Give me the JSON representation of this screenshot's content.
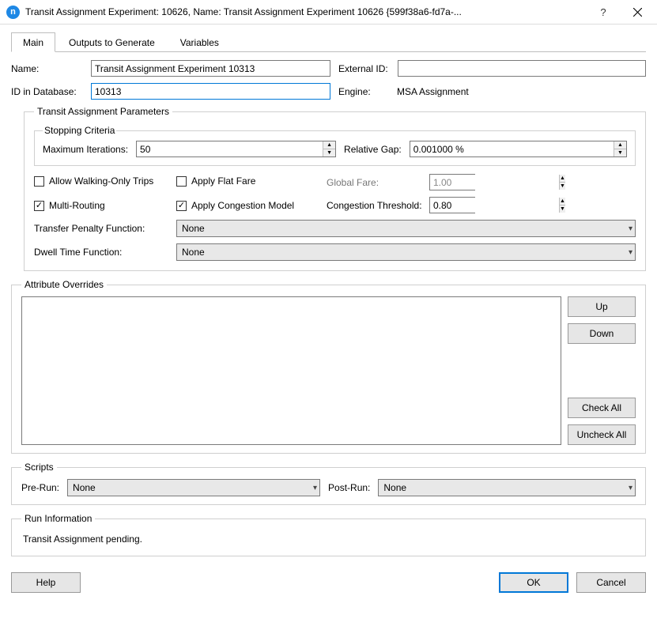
{
  "title": "Transit Assignment Experiment: 10626, Name: Transit Assignment Experiment 10626  {599f38a6-fd7a-...",
  "tabs": {
    "main": "Main",
    "outputs": "Outputs to Generate",
    "variables": "Variables"
  },
  "labels": {
    "name": "Name:",
    "external_id": "External ID:",
    "id_db": "ID in Database:",
    "engine": "Engine:"
  },
  "values": {
    "name": "Transit Assignment Experiment 10313",
    "external_id": "",
    "id_db": "10313",
    "engine": "MSA Assignment"
  },
  "params": {
    "legend": "Transit Assignment Parameters",
    "stopping_legend": "Stopping Criteria",
    "max_iter_label": "Maximum Iterations:",
    "max_iter_value": "50",
    "rel_gap_label": "Relative Gap:",
    "rel_gap_value": "0.001000 %",
    "allow_walking": "Allow Walking-Only Trips",
    "apply_flat_fare": "Apply Flat Fare",
    "global_fare_label": "Global Fare:",
    "global_fare_value": "1.00",
    "multi_routing": "Multi-Routing",
    "apply_congestion": "Apply Congestion Model",
    "congestion_thresh_label": "Congestion Threshold:",
    "congestion_thresh_value": "0.80",
    "transfer_penalty_label": "Transfer Penalty Function:",
    "transfer_penalty_value": "None",
    "dwell_label": "Dwell Time Function:",
    "dwell_value": "None"
  },
  "overrides": {
    "legend": "Attribute Overrides",
    "up": "Up",
    "down": "Down",
    "check_all": "Check All",
    "uncheck_all": "Uncheck All"
  },
  "scripts": {
    "legend": "Scripts",
    "pre_label": "Pre-Run:",
    "pre_value": "None",
    "post_label": "Post-Run:",
    "post_value": "None"
  },
  "run_info": {
    "legend": "Run Information",
    "status": "Transit Assignment pending."
  },
  "footer": {
    "help": "Help",
    "ok": "OK",
    "cancel": "Cancel"
  }
}
